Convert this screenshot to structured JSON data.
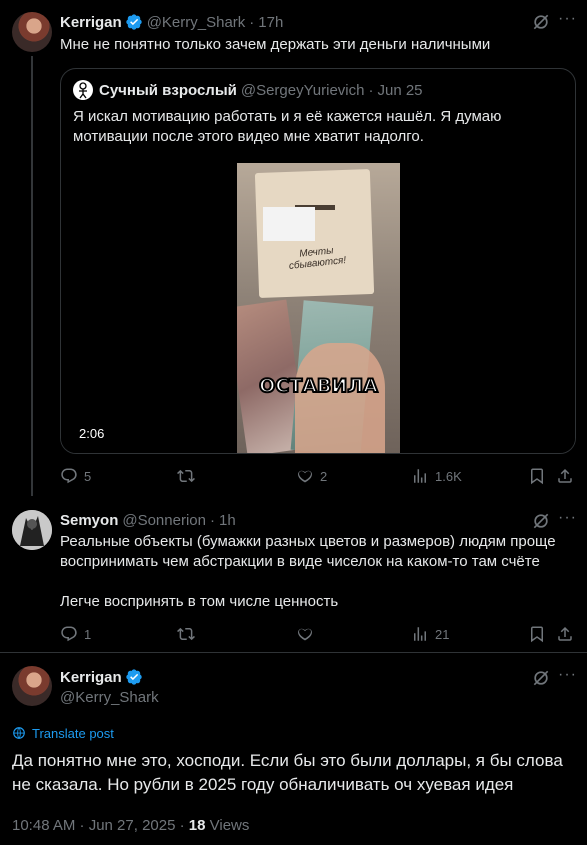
{
  "post1": {
    "name": "Kerrigan",
    "handle": "@Kerry_Shark",
    "time": "17h",
    "text": "Мне не понятно только зачем держать эти деньги наличными",
    "quote": {
      "name": "Сучный взрослый",
      "handle": "@SergeyYurievich",
      "date": "Jun 25",
      "text": "Я искал мотивацию работать и я её кажется нашёл. Я думаю мотивации после этого видео мне хватит надолго.",
      "video_duration": "2:06",
      "video_caption": "ОСТАВИЛА",
      "box_text": "Мечты сбываются!"
    },
    "stats": {
      "replies": "5",
      "reposts": "",
      "likes": "2",
      "views": "1.6K"
    }
  },
  "post2": {
    "name": "Semyon",
    "handle": "@Sonnerion",
    "time": "1h",
    "text1": "Реальные объекты (бумажки разных цветов и размеров) людям проще воспринимать чем абстракции в виде чиселок на каком-то там счёте",
    "text2": "Легче воспринять в том числе ценность",
    "stats": {
      "replies": "1",
      "reposts": "",
      "likes": "",
      "views": "21"
    }
  },
  "post3": {
    "name": "Kerrigan",
    "handle": "@Kerry_Shark",
    "translate": "Translate post",
    "text": "Да понятно мне это, хосподи. Если бы это были доллары, я бы слова не сказала. Но рубли в 2025 году обналичивать оч хуевая идея",
    "timestamp": "10:48 AM · Jun 27, 2025 · ",
    "views_count": "18",
    "views_label": " Views"
  },
  "colors": {
    "accent": "#1d9bf0",
    "muted": "#71767b",
    "text": "#e7e9ea",
    "bg": "#000000"
  },
  "icons": [
    "verified-badge-icon",
    "grok-icon",
    "more-icon",
    "reply-icon",
    "repost-icon",
    "like-icon",
    "views-icon",
    "bookmark-icon",
    "share-icon",
    "globe-icon"
  ]
}
